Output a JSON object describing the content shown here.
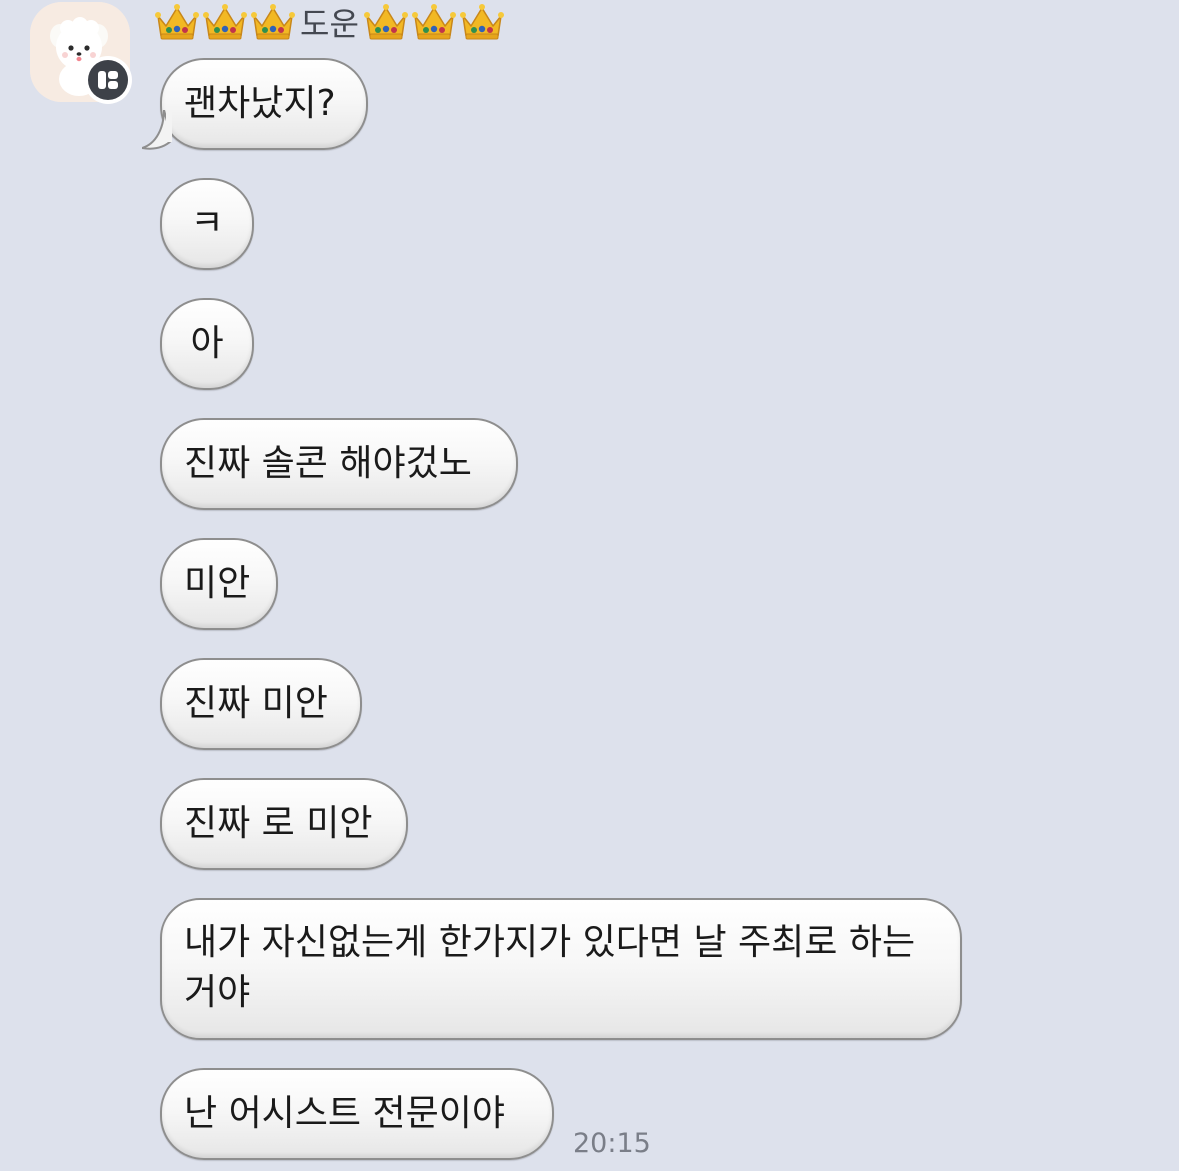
{
  "sender": {
    "name": "도운",
    "crowns_before": 3,
    "crowns_after": 3,
    "crown_icon": "crown-emoji"
  },
  "avatar": {
    "icon": "white-puppy-avatar",
    "badge_icon": "app-badge-icon"
  },
  "messages": [
    {
      "text": "괜차났지?"
    },
    {
      "text": "ㅋ"
    },
    {
      "text": "아"
    },
    {
      "text": "진짜 솔콘 해야겄노"
    },
    {
      "text": "미안"
    },
    {
      "text": "진짜 미안"
    },
    {
      "text": "진짜 로 미안"
    },
    {
      "text": "내가 자신없는게 한가지가 있다면 날 주최로 하는거야"
    },
    {
      "text": "난 어시스트 전문이야"
    }
  ],
  "timestamp": "20:15",
  "colors": {
    "background": "#dde1ec",
    "bubble_border": "#8e8e8e",
    "text": "#1a1a1a",
    "timestamp": "#7a7e88"
  }
}
